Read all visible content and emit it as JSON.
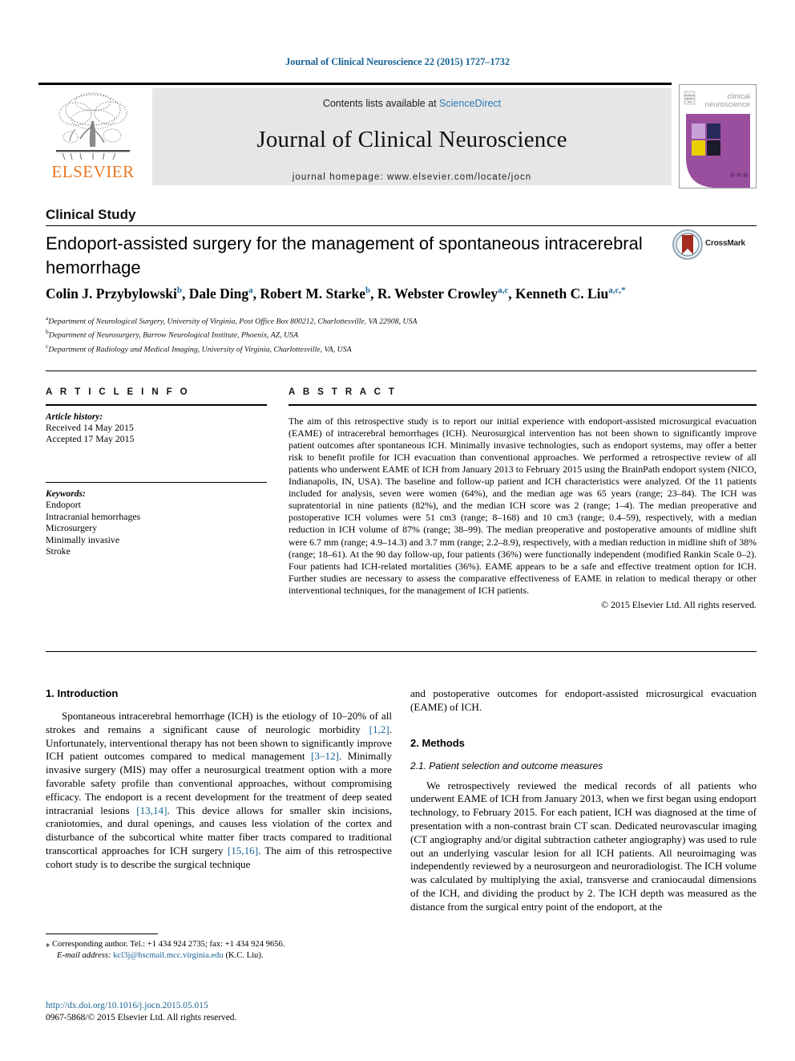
{
  "running_head": "Journal of Clinical Neuroscience 22 (2015) 1727–1732",
  "masthead": {
    "publisher_name": "ELSEVIER",
    "contents_prefix": "Contents lists available at ",
    "contents_link": "ScienceDirect",
    "journal_name": "Journal of Clinical Neuroscience",
    "homepage": "journal homepage: www.elsevier.com/locate/jocn",
    "cover_title_line1": "clinical",
    "cover_title_line2": "neuroscience",
    "cover_color": "#9a4f9e"
  },
  "article": {
    "section_label": "Clinical Study",
    "title": "Endoport-assisted surgery for the management of spontaneous intracerebral hemorrhage",
    "crossmark_label": "CrossMark",
    "authors": [
      {
        "name": "Colin J. Przybylowski",
        "marks": "b"
      },
      {
        "name": "Dale Ding",
        "marks": "a"
      },
      {
        "name": "Robert M. Starke",
        "marks": "b"
      },
      {
        "name": "R. Webster Crowley",
        "marks": "a,c"
      },
      {
        "name": "Kenneth C. Liu",
        "marks": "a,c,*"
      }
    ],
    "affiliations": [
      {
        "mark": "a",
        "text": "Department of Neurological Surgery, University of Virginia, Post Office Box 800212, Charlottesville, VA 22908, USA"
      },
      {
        "mark": "b",
        "text": "Department of Neurosurgery, Barrow Neurological Institute, Phoenix, AZ, USA"
      },
      {
        "mark": "c",
        "text": "Department of Radiology and Medical Imaging, University of Virginia, Charlottesville, VA, USA"
      }
    ]
  },
  "article_info": {
    "heading": "A R T I C L E     I N F O",
    "history_label": "Article history:",
    "history": [
      "Received 14 May 2015",
      "Accepted 17 May 2015"
    ],
    "keywords_label": "Keywords:",
    "keywords": [
      "Endoport",
      "Intracranial hemorrhages",
      "Microsurgery",
      "Minimally invasive",
      "Stroke"
    ]
  },
  "abstract": {
    "heading": "A B S T R A C T",
    "text": "The aim of this retrospective study is to report our initial experience with endoport-assisted microsurgical evacuation (EAME) of intracerebral hemorrhages (ICH). Neurosurgical intervention has not been shown to significantly improve patient outcomes after spontaneous ICH. Minimally invasive technologies, such as endoport systems, may offer a better risk to benefit profile for ICH evacuation than conventional approaches. We performed a retrospective review of all patients who underwent EAME of ICH from January 2013 to February 2015 using the BrainPath endoport system (NICO, Indianapolis, IN, USA). The baseline and follow-up patient and ICH characteristics were analyzed. Of the 11 patients included for analysis, seven were women (64%), and the median age was 65 years (range; 23–84). The ICH was supratentorial in nine patients (82%), and the median ICH score was 2 (range; 1–4). The median preoperative and postoperative ICH volumes were 51 cm3 (range; 8–168) and 10 cm3 (range; 0.4–59), respectively, with a median reduction in ICH volume of 87% (range; 38–99). The median preoperative and postoperative amounts of midline shift were 6.7 mm (range; 4.9–14.3) and 3.7 mm (range; 2.2–8.9), respectively, with a median reduction in midline shift of 38% (range; 18–61). At the 90 day follow-up, four patients (36%) were functionally independent (modified Rankin Scale 0–2). Four patients had ICH-related mortalities (36%). EAME appears to be a safe and effective treatment option for ICH. Further studies are necessary to assess the comparative effectiveness of EAME in relation to medical therapy or other interventional techniques, for the management of ICH patients.",
    "copyright": "© 2015 Elsevier Ltd. All rights reserved."
  },
  "body": {
    "intro_heading": "1. Introduction",
    "intro_para_1a": "Spontaneous intracerebral hemorrhage (ICH) is the etiology of 10–20% of all strokes and remains a significant cause of neurologic morbidity ",
    "intro_ref_1": "[1,2]",
    "intro_para_1b": ". Unfortunately, interventional therapy has not been shown to significantly improve ICH patient outcomes compared to medical management ",
    "intro_ref_2": "[3–12]",
    "intro_para_1c": ". Minimally invasive surgery (MIS) may offer a neurosurgical treatment option with a more favorable safety profile than conventional approaches, without compromising efficacy. The endoport is a recent development for the treatment of deep seated intracranial lesions ",
    "intro_ref_3": "[13,14]",
    "intro_para_1d": ". This device allows for smaller skin incisions, craniotomies, and dural openings, and causes less violation of the cortex and disturbance of the subcortical white matter fiber tracts compared to traditional transcortical approaches for ICH surgery ",
    "intro_ref_4": "[15,16]",
    "intro_para_1e": ". The aim of this retrospective cohort study is to describe the surgical technique",
    "intro_continuation": "and postoperative outcomes for endoport-assisted microsurgical evacuation (EAME) of ICH.",
    "methods_heading": "2. Methods",
    "methods_sub_heading": "2.1. Patient selection and outcome measures",
    "methods_para": "We retrospectively reviewed the medical records of all patients who underwent EAME of ICH from January 2013, when we first began using endoport technology, to February 2015. For each patient, ICH was diagnosed at the time of presentation with a non-contrast brain CT scan. Dedicated neurovascular imaging (CT angiography and/or digital subtraction catheter angiography) was used to rule out an underlying vascular lesion for all ICH patients. All neuroimaging was independently reviewed by a neurosurgeon and neuroradiologist. The ICH volume was calculated by multiplying the axial, transverse and craniocaudal dimensions of the ICH, and dividing the product by 2. The ICH depth was measured as the distance from the surgical entry point of the endoport, at the"
  },
  "footnotes": {
    "corresponding_mark": "⁎",
    "corresponding_text": "Corresponding author. Tel.: +1 434 924 2735; fax: +1 434 924 9656.",
    "email_label": "E-mail address:",
    "email": "kcl3j@hscmail.mcc.virginia.edu",
    "email_attrib": "(K.C. Liu).",
    "doi": "http://dx.doi.org/10.1016/j.jocn.2015.05.015",
    "issn_line": "0967-5868/© 2015 Elsevier Ltd. All rights reserved."
  }
}
